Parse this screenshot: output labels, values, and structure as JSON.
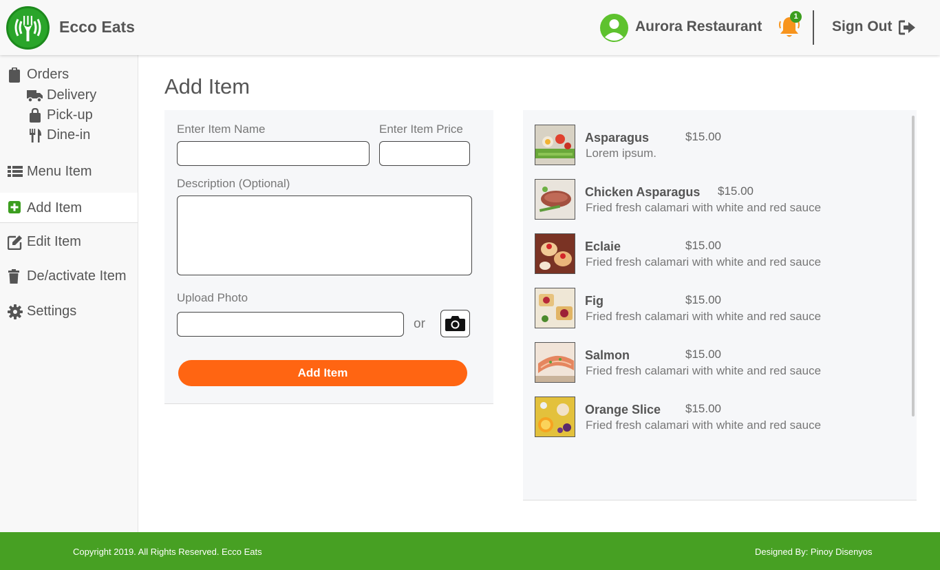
{
  "app": {
    "brand": "Ecco Eats"
  },
  "colors": {
    "accent": "#ff6512",
    "brand_green": "#47a023",
    "bell": "#f7941d"
  },
  "header": {
    "restaurant_name": "Aurora Restaurant",
    "notification_count": "1",
    "signout_label": "Sign Out"
  },
  "sidebar": {
    "items": [
      {
        "label": "Orders",
        "icon": "clipboard-icon"
      },
      {
        "label": "Delivery",
        "icon": "truck-icon"
      },
      {
        "label": "Pick-up",
        "icon": "shopping-bag-icon"
      },
      {
        "label": "Dine-in",
        "icon": "utensils-icon"
      },
      {
        "label": "Menu Item",
        "icon": "list-icon"
      },
      {
        "label": "Add Item",
        "icon": "plus-square-icon",
        "active": true
      },
      {
        "label": "Edit Item",
        "icon": "edit-icon"
      },
      {
        "label": "De/activate Item",
        "icon": "trash-icon"
      },
      {
        "label": "Settings",
        "icon": "gear-icon"
      }
    ]
  },
  "main": {
    "title": "Add Item",
    "form": {
      "name_label": "Enter Item Name",
      "name_value": "",
      "price_label": "Enter Item Price",
      "price_value": "",
      "description_label": "Description (Optional)",
      "description_value": "",
      "upload_label": "Upload Photo",
      "upload_value": "",
      "or_text": "or",
      "submit_label": "Add Item"
    },
    "items": [
      {
        "name": "Asparagus",
        "price": "$15.00",
        "description": "Lorem ipsum."
      },
      {
        "name": "Chicken Asparagus",
        "price": "$15.00",
        "description": "Fried fresh calamari with white and red sauce"
      },
      {
        "name": "Eclaie",
        "price": "$15.00",
        "description": "Fried fresh calamari with white and red sauce"
      },
      {
        "name": "Fig",
        "price": "$15.00",
        "description": "Fried fresh calamari with white and red sauce"
      },
      {
        "name": "Salmon",
        "price": "$15.00",
        "description": "Fried fresh calamari with white and red sauce"
      },
      {
        "name": "Orange Slice",
        "price": "$15.00",
        "description": "Fried fresh calamari with white and red sauce"
      }
    ]
  },
  "footer": {
    "copyright": "Copyright 2019. All Rights Reserved. Ecco Eats",
    "designer": "Designed By: Pinoy Disenyos"
  }
}
